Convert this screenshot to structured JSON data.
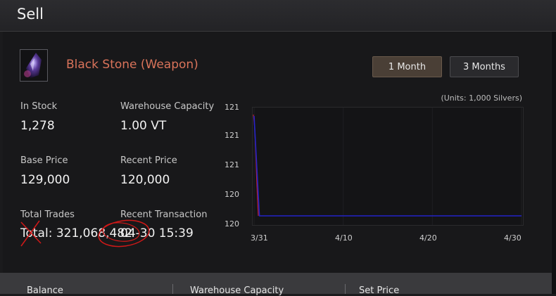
{
  "window": {
    "title": "Sell"
  },
  "item": {
    "name": "Black Stone (Weapon)",
    "icon": "black-stone-gem-icon"
  },
  "stats": {
    "in_stock_label": "In Stock",
    "in_stock_value": "1,278",
    "warehouse_label": "Warehouse Capacity",
    "warehouse_value": "1.00 VT",
    "base_price_label": "Base Price",
    "base_price_value": "129,000",
    "recent_price_label": "Recent Price",
    "recent_price_value": "120,000",
    "total_trades_label": "Total Trades",
    "total_trades_value": "Total: 321,068,482",
    "recent_tx_label": "Recent Transaction",
    "recent_tx_value": "04-30 15:39"
  },
  "period": {
    "one_month": "1 Month",
    "three_months": "3 Months",
    "selected": "1 Month"
  },
  "chart_data": {
    "type": "line",
    "units_note": "(Units: 1,000 Silvers)",
    "x_ticks": [
      "3/31",
      "4/10",
      "4/20",
      "4/30"
    ],
    "y_ticks": [
      "121",
      "121",
      "121",
      "120",
      "120"
    ],
    "series": [
      {
        "color": "#2323c8",
        "x": [
          0,
          0.02,
          1.0
        ],
        "y": [
          121,
          120,
          120
        ]
      }
    ],
    "spike_color": "#c02030"
  },
  "footer": {
    "balance_label": "Balance",
    "warehouse_label": "Warehouse Capacity",
    "set_price_label": "Set Price"
  },
  "colors": {
    "accent": "#d9735a",
    "active_button": "#4a3f36"
  }
}
